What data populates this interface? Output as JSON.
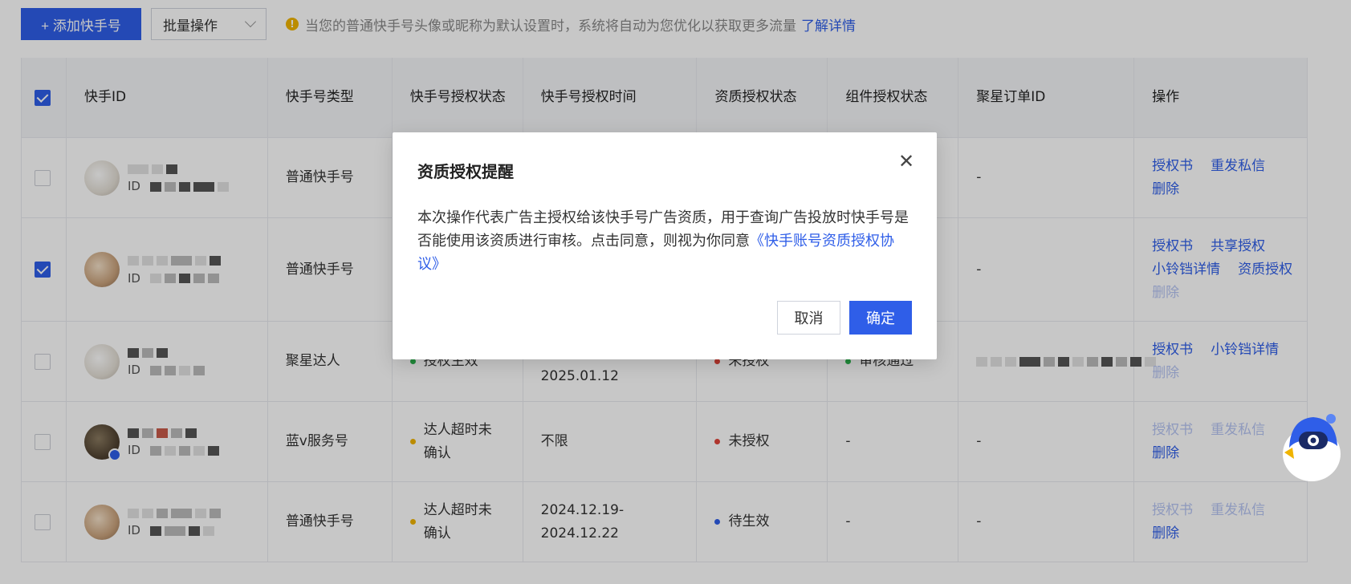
{
  "toolbar": {
    "add_label": "+ 添加快手号",
    "batch_label": "批量操作",
    "notice_text": "当您的普通快手号头像或昵称为默认设置时，系统将自动为您优化以获取更多流量",
    "notice_link": "了解详情"
  },
  "table": {
    "headers": [
      "快手ID",
      "快手号类型",
      "快手号授权状态",
      "快手号授权时间",
      "资质授权状态",
      "组件授权状态",
      "聚星订单ID",
      "操作"
    ],
    "id_prefix": "ID",
    "rows": [
      {
        "checked": false,
        "type": "普通快手号",
        "auth_status": "",
        "auth_time": "",
        "qual_status": "",
        "comp_status": "",
        "order_id": "-",
        "ops": [
          {
            "label": "授权书",
            "enabled": true
          },
          {
            "label": "重发私信",
            "enabled": true
          },
          {
            "label": "删除",
            "enabled": true
          }
        ]
      },
      {
        "checked": true,
        "type": "普通快手号",
        "auth_status": "",
        "auth_time": "",
        "qual_status": "",
        "comp_status": "",
        "order_id": "-",
        "ops": [
          {
            "label": "授权书",
            "enabled": true
          },
          {
            "label": "共享授权",
            "enabled": true
          },
          {
            "label": "小铃铛详情",
            "enabled": true
          },
          {
            "label": "资质授权",
            "enabled": true
          },
          {
            "label": "删除",
            "enabled": false
          }
        ]
      },
      {
        "checked": false,
        "type": "聚星达人",
        "auth_status": "授权生效",
        "auth_dot": "#2bb24c",
        "auth_time": "2025.01.12",
        "qual_status": "未授权",
        "qual_dot": "#e0453a",
        "comp_status": "审核通过",
        "comp_dot": "#2bb24c",
        "order_id": "",
        "ops": [
          {
            "label": "授权书",
            "enabled": true
          },
          {
            "label": "小铃铛详情",
            "enabled": true
          },
          {
            "label": "删除",
            "enabled": false
          }
        ]
      },
      {
        "checked": false,
        "type": "蓝v服务号",
        "auth_status": "达人超时未确认",
        "auth_dot": "#f0b400",
        "auth_time": "不限",
        "qual_status": "未授权",
        "qual_dot": "#e0453a",
        "comp_status": "-",
        "order_id": "-",
        "ops": [
          {
            "label": "授权书",
            "enabled": false
          },
          {
            "label": "重发私信",
            "enabled": false
          },
          {
            "label": "删除",
            "enabled": true
          }
        ]
      },
      {
        "checked": false,
        "type": "普通快手号",
        "auth_status": "达人超时未确认",
        "auth_dot": "#f0b400",
        "auth_time": "2024.12.19-2024.12.22",
        "qual_status": "待生效",
        "qual_dot": "#2f5ee8",
        "comp_status": "-",
        "order_id": "-",
        "ops": [
          {
            "label": "授权书",
            "enabled": false
          },
          {
            "label": "重发私信",
            "enabled": false
          },
          {
            "label": "删除",
            "enabled": true
          }
        ]
      }
    ]
  },
  "modal": {
    "title": "资质授权提醒",
    "body": "本次操作代表广告主授权给该快手号广告资质，用于查询广告投放时快手号是否能使用该资质进行审核。点击同意，则视为你同意",
    "agreement_link": "《快手账号资质授权协议》",
    "cancel_label": "取消",
    "ok_label": "确定",
    "close_icon": "close-icon"
  },
  "colors": {
    "primary": "#2f5ee8",
    "warning": "#f0b400",
    "success": "#2bb24c",
    "danger": "#e0453a"
  }
}
